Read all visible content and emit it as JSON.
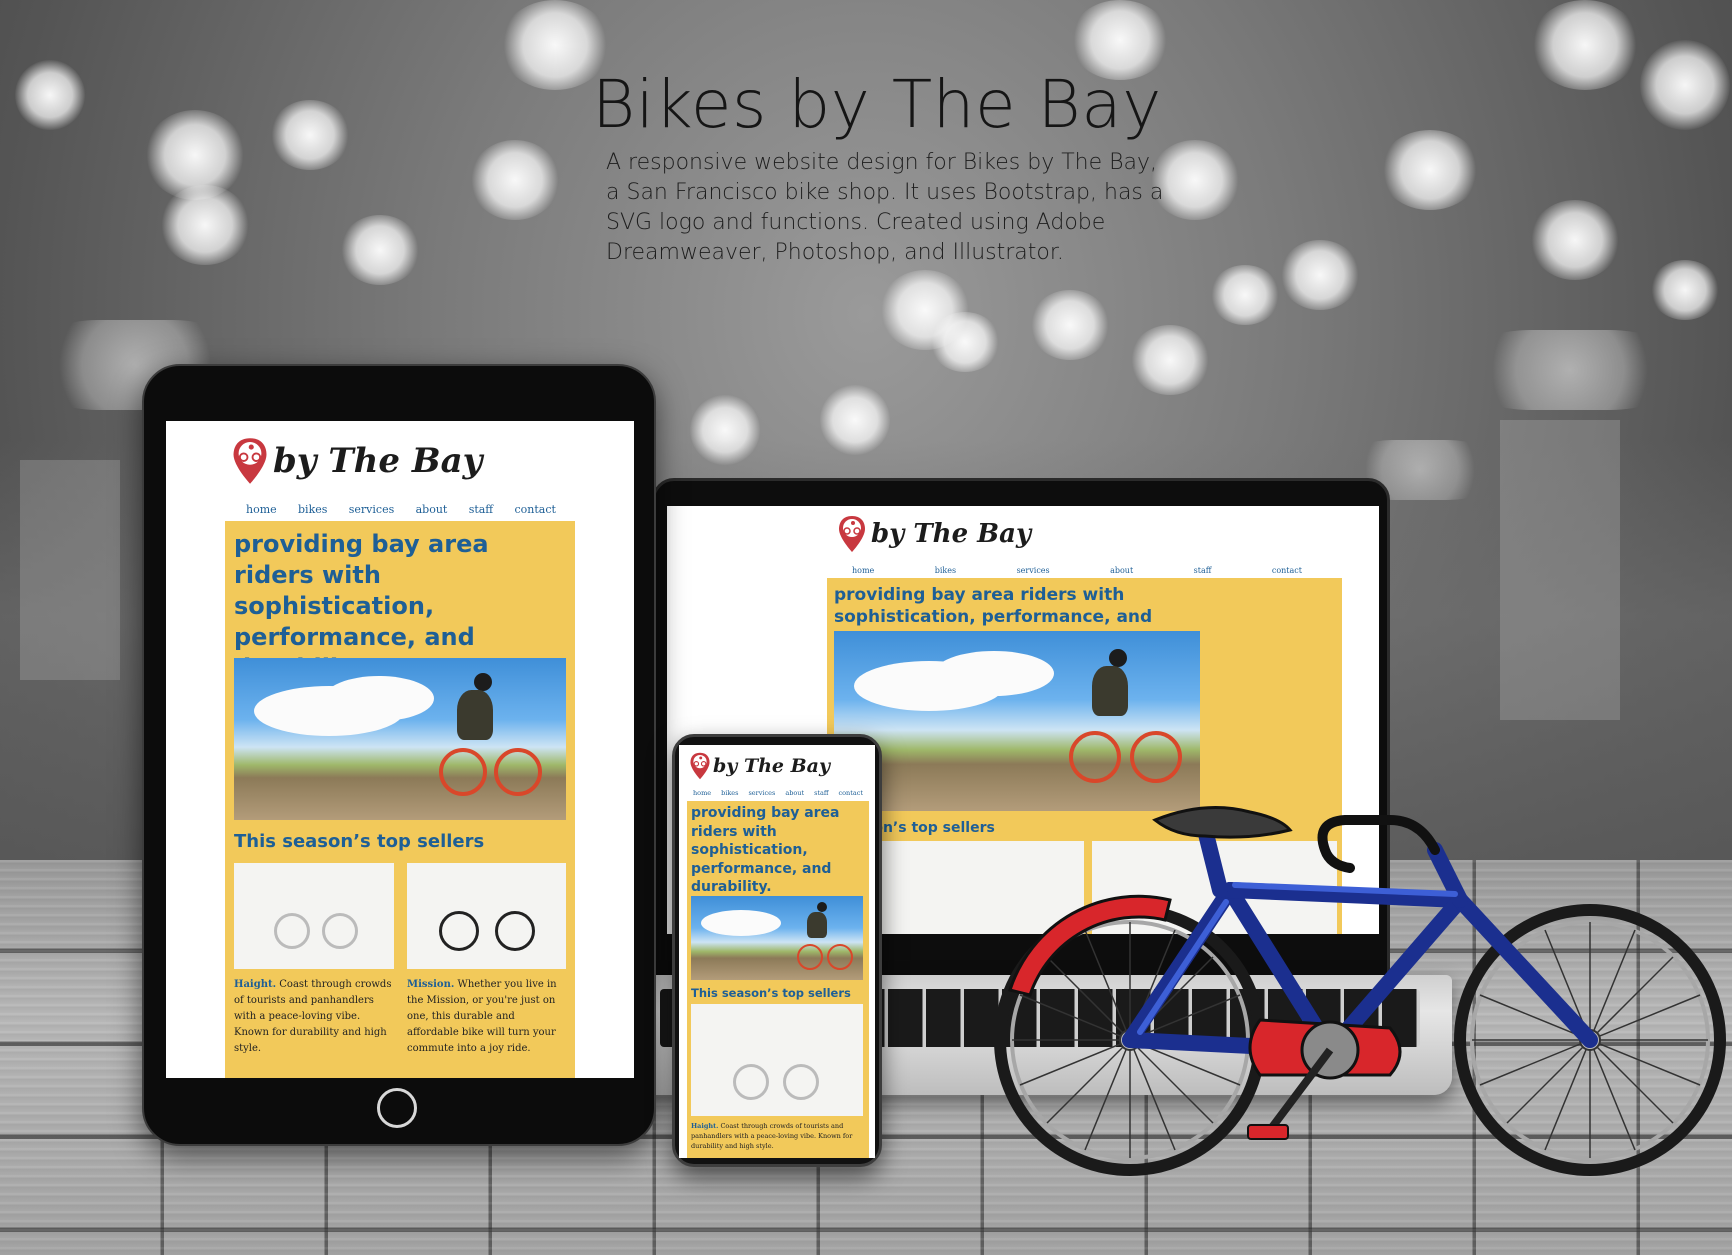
{
  "headline": "Bikes by The Bay",
  "description": "A responsive website design for Bikes by The Bay, a San Francisco bike shop. It uses Bootstrap, has a SVG logo and functions. Created using Adobe Dreamweaver, Photoshop, and Illustrator.",
  "site": {
    "logo_text": "by The Bay",
    "nav": [
      "home",
      "bikes",
      "services",
      "about",
      "staff",
      "contact"
    ],
    "hero_text": "providing bay area riders with sophistication, performance, and durability.",
    "sellers_title": "This season’s top sellers",
    "products": [
      {
        "name": "Haight.",
        "copy": "Coast through crowds of tourists and panhandlers with a peace-loving vibe. Known for durability and high style."
      },
      {
        "name": "Mission.",
        "copy": "Whether you live in the Mission, or you're just on one, this durable and affordable bike will turn your commute into a joy ride."
      }
    ],
    "laptop_sellers_title": "son’s top sellers"
  },
  "colors": {
    "accent_yellow": "#f2c95a",
    "link_blue": "#1e5f96",
    "logo_pin_red": "#c8383f"
  },
  "icons": [
    "map-pin-cyclist-icon"
  ]
}
